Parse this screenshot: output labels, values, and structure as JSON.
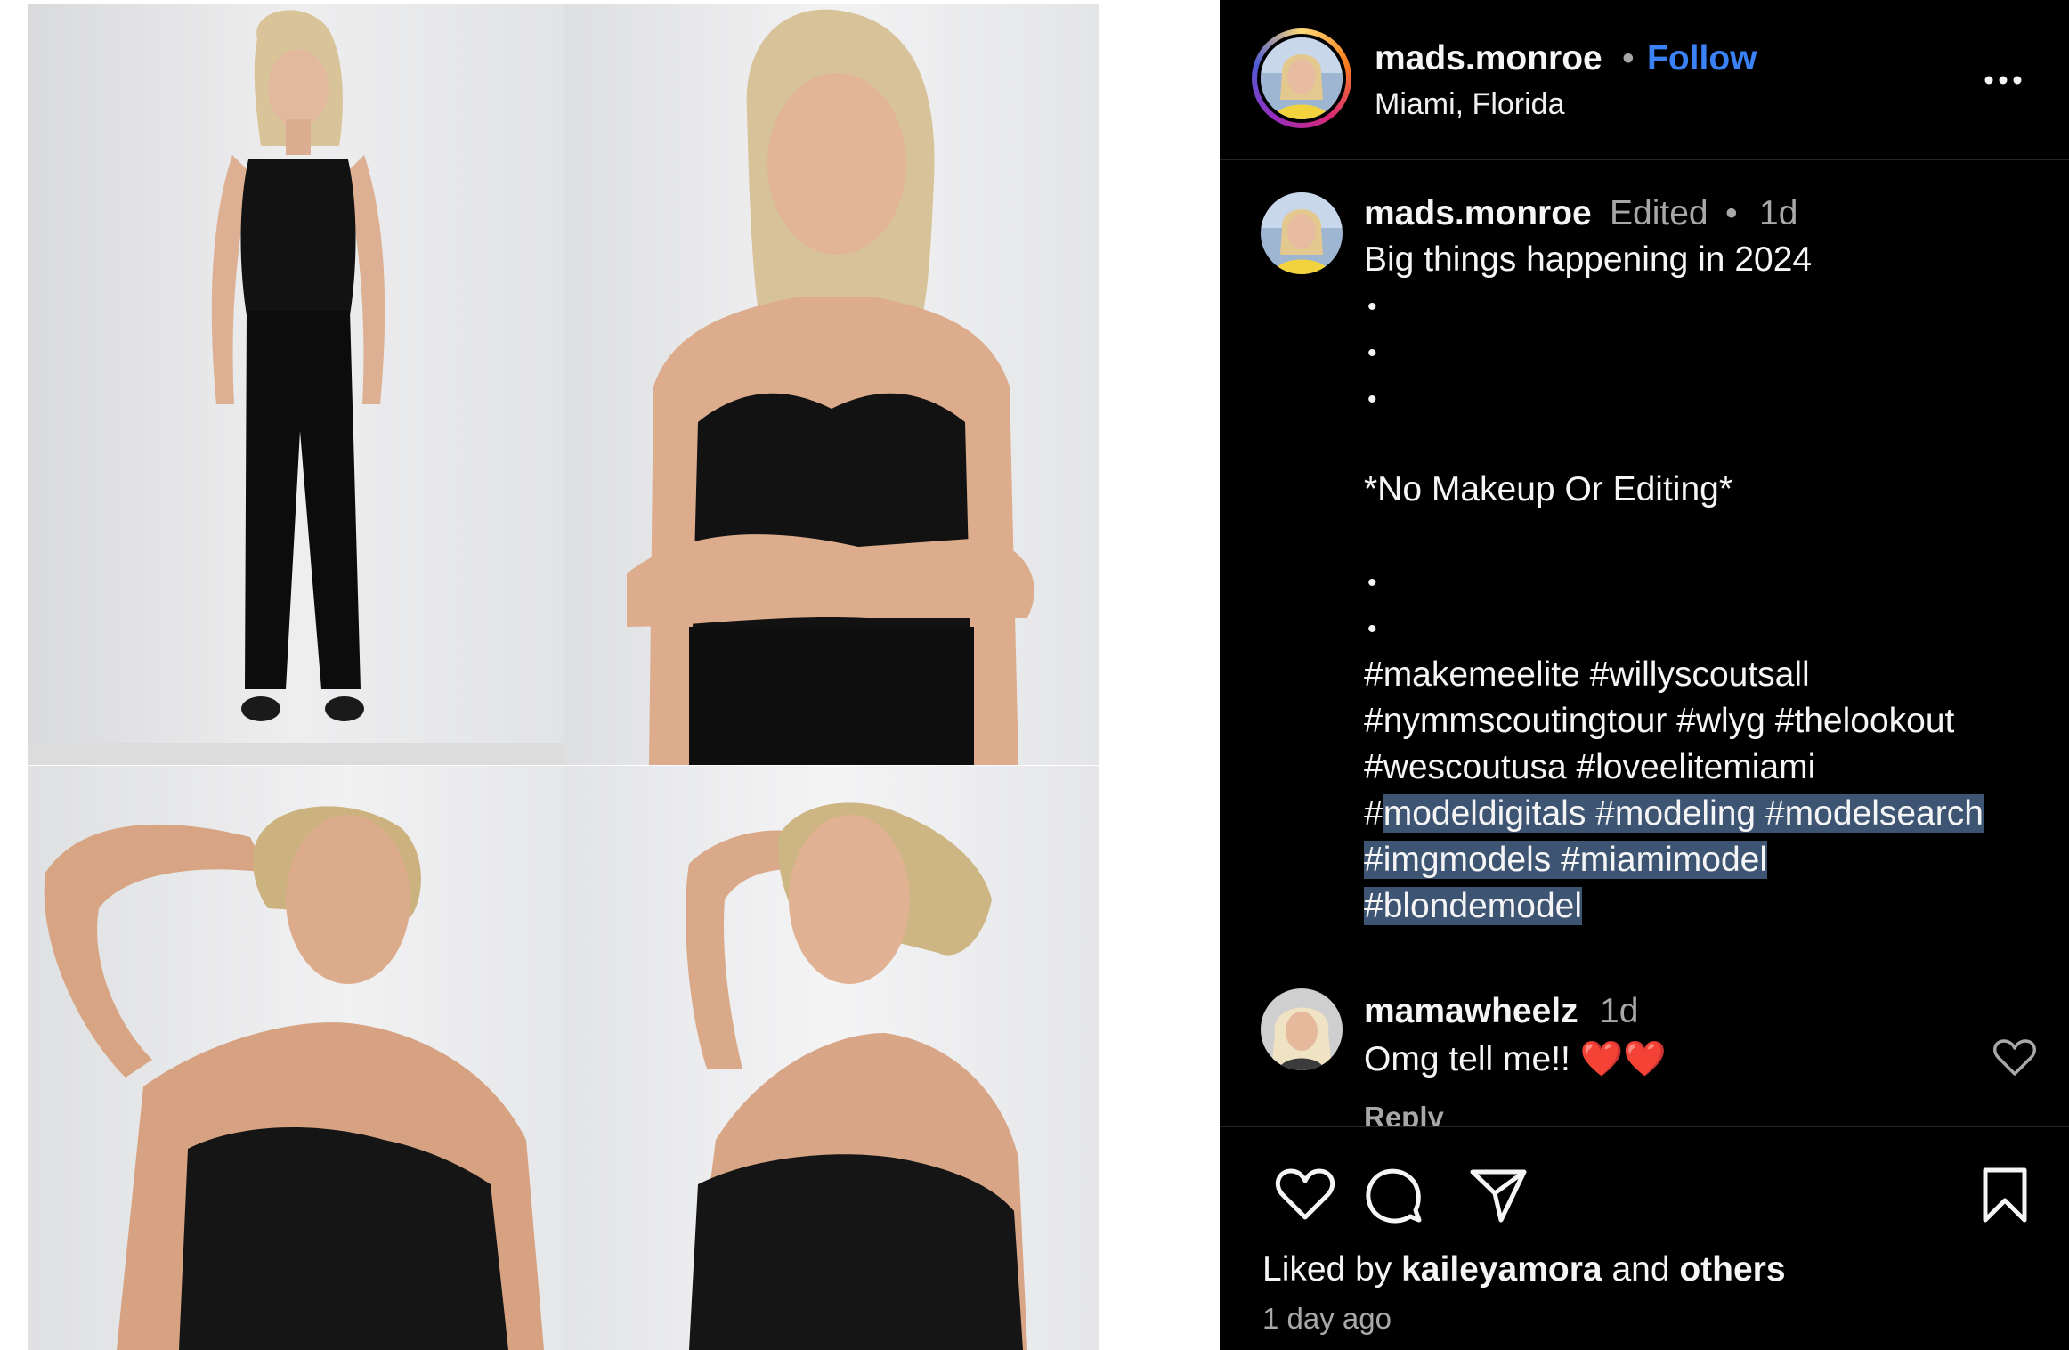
{
  "app": "Instagram",
  "post": {
    "username": "mads.monroe",
    "separator": "•",
    "follow_label": "Follow",
    "location": "Miami, Florida",
    "more_icon": "more-options-icon"
  },
  "photos": [
    {
      "description_name": "full-body-standing-photo"
    },
    {
      "description_name": "arms-crossed-portrait-photo"
    },
    {
      "description_name": "hand-behind-head-looking-right-photo"
    },
    {
      "description_name": "profile-hand-in-hair-photo"
    }
  ],
  "caption": {
    "username": "mads.monroe",
    "edited": "Edited",
    "dot": "•",
    "time": "1d",
    "title": "Big things happening in 2024",
    "bullet": "•",
    "note": "*No Makeup Or Editing*",
    "hashtags_line1": "#makemeelite #willyscoutsall",
    "hashtags_line2": "#nymmscoutingtour #wlyg #thelookout",
    "hashtags_line3": "#wescoutusa #loveelitemiami",
    "hashtags_line4_prefix": "#",
    "hashtags_line4_highlighted": "modeldigitals #modeling #modelsearch",
    "hashtags_line5": "#imgmodels #miamimodel",
    "hashtags_line6": "#blondemodel"
  },
  "comment": {
    "username": "mamawheelz",
    "time": "1d",
    "text": "Omg tell me!! ❤️❤️",
    "reply_label": "Reply"
  },
  "actions": {
    "like_icon": "heart-icon",
    "comment_icon": "comment-icon",
    "share_icon": "share-icon",
    "save_icon": "bookmark-icon"
  },
  "likes": {
    "prefix": "Liked by ",
    "user": "kaileyamora",
    "middle": " and ",
    "others": "others"
  },
  "posted_ago": "1 day ago",
  "colors": {
    "sidebar_bg": "#000000",
    "follow_blue": "#3b82f6",
    "selection": "#3d5573",
    "muted_text": "#a8a8a8"
  }
}
